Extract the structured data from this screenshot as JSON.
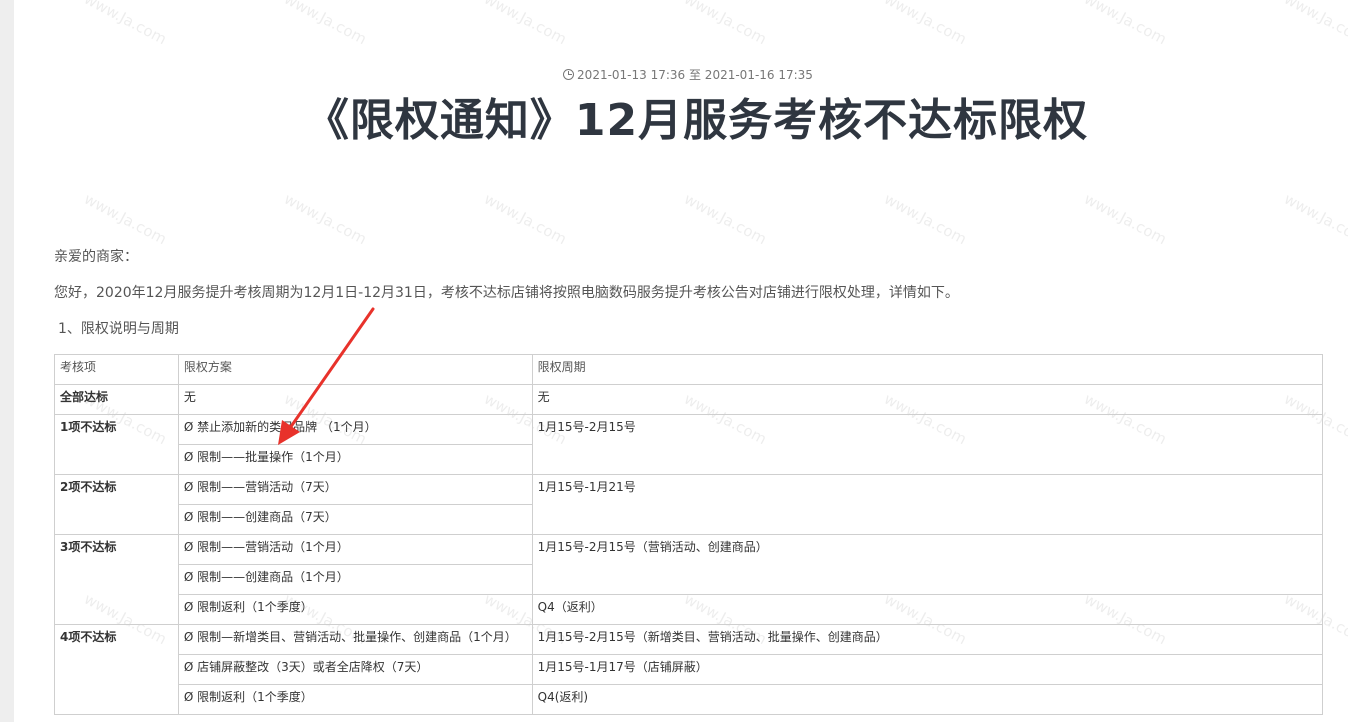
{
  "meta": {
    "date_range": "2021-01-13 17:36 至 2021-01-16 17:35",
    "title": "《限权通知》12月服务考核不达标限权"
  },
  "body": {
    "greeting": "亲爱的商家：",
    "intro": "您好，2020年12月服务提升考核周期为12月1日-12月31日，考核不达标店铺将按照电脑数码服务提升考核公告对店铺进行限权处理，详情如下。",
    "section_heading": "1、限权说明与周期"
  },
  "table": {
    "headers": [
      "考核项",
      "限权方案",
      "限权周期"
    ],
    "rows": [
      [
        "全部达标",
        "无",
        "无"
      ],
      [
        "1项不达标",
        "Ø  禁止添加新的类目品牌 （1个月）",
        "1月15号-2月15号"
      ],
      [
        "",
        "Ø  限制——批量操作（1个月）",
        ""
      ],
      [
        "2项不达标",
        "Ø  限制——营销活动（7天）",
        "1月15号-1月21号"
      ],
      [
        "",
        "Ø  限制——创建商品（7天）",
        ""
      ],
      [
        "3项不达标",
        "Ø  限制——营销活动（1个月）",
        "1月15号-2月15号（营销活动、创建商品）"
      ],
      [
        "",
        "Ø  限制——创建商品（1个月）",
        ""
      ],
      [
        "",
        "Ø  限制返利（1个季度）",
        "Q4（返利）"
      ],
      [
        "4项不达标",
        "Ø  限制—新增类目、营销活动、批量操作、创建商品（1个月）",
        "1月15号-2月15号（新增类目、营销活动、批量操作、创建商品）"
      ],
      [
        "",
        "Ø  店铺屏蔽整改（3天）或者全店降权（7天）",
        "1月15号-1月17号（店铺屏蔽）"
      ],
      [
        "",
        "Ø  限制返利（1个季度）",
        "Q4(返利)"
      ]
    ]
  },
  "watermark": "www.Ja.com",
  "colors": {
    "arrow": "#e8322b",
    "title": "#2f3640"
  }
}
